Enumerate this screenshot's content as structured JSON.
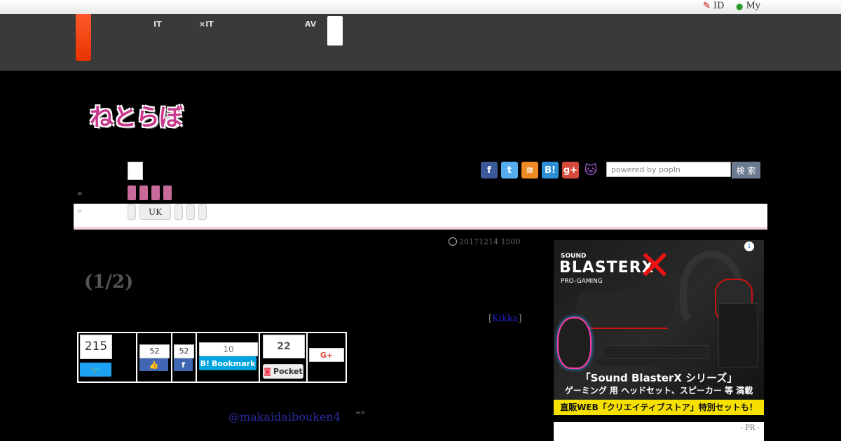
{
  "utility": {
    "id_label": "ID",
    "my_label": "My"
  },
  "nav": {
    "item1_line1": "",
    "item1_line2": "IT",
    "item2_line1": "",
    "item2_line2": "×IT",
    "item3_line1": "AV",
    "item3_line2": ""
  },
  "logo": {
    "text": "ねとらぼ"
  },
  "share_icons": [
    "facebook-icon",
    "twitter-icon",
    "rss-icon",
    "hatena-icon",
    "googleplus-icon",
    "cat-icon"
  ],
  "search": {
    "placeholder": "powered by popIn",
    "button": "検 索"
  },
  "breadcrumb": {
    "row1_prefix": "»",
    "row2_prefix": "»",
    "uk_label": "UK"
  },
  "article": {
    "date": "20171214 1500",
    "title": "(1/2)",
    "author_open": "[",
    "author_name": "Kikka",
    "author_close": "]",
    "tweet_handle": "@makaidaibouken4",
    "quote": "“”"
  },
  "social_counts": {
    "twitter_count": "215",
    "fb_like_count": "52",
    "fb_share_count": "52",
    "hatena_count": "10",
    "hatena_label": "Bookmark",
    "pocket_count": "22",
    "pocket_label": "Pocket",
    "gplus_label": "G+"
  },
  "ad": {
    "brand_line1": "SOUND",
    "brand_line2": "BLASTERX",
    "brand_line3": "PRO-GAMING",
    "banner1": "「Sound BlasterX シリーズ」",
    "banner2": "ゲーミング 用 ヘッドセット、スピーカー 等 満載",
    "banner3": "直販WEB「クリエイティブストア」特別セットも！"
  },
  "pr_label": "- PR -",
  "colors": {
    "accent_pink": "#c86b9a",
    "nav_bg": "#3a3a3a",
    "red_tab": "#e63300"
  }
}
